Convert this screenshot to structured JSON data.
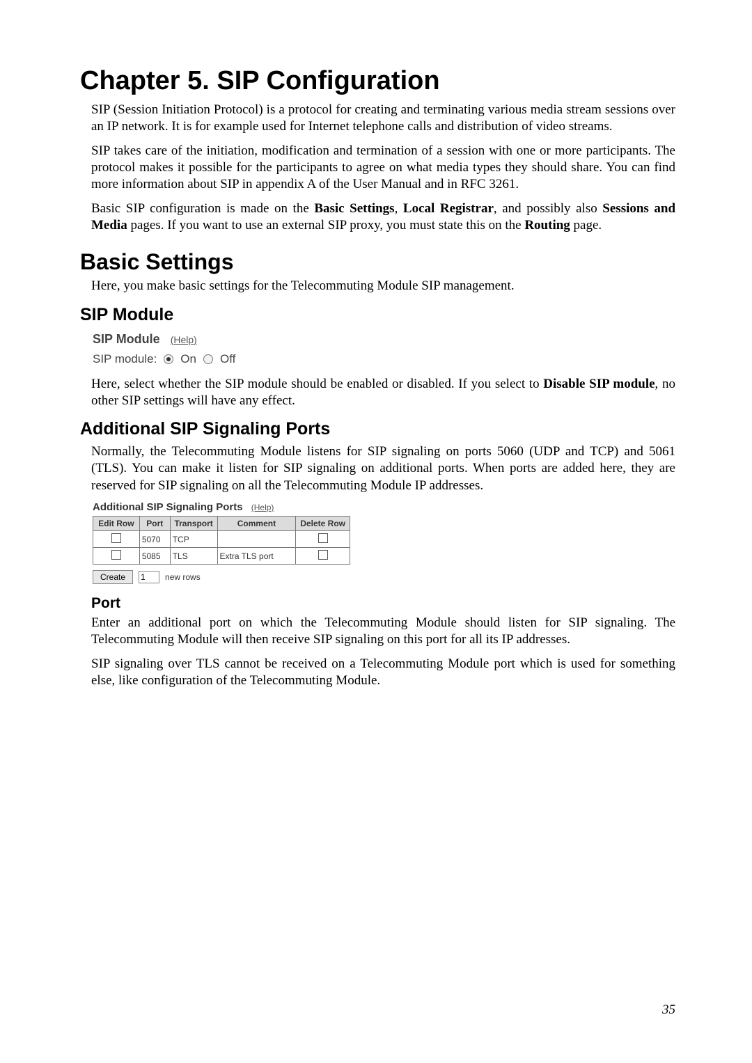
{
  "chapter_title": "Chapter 5. SIP Configuration",
  "para_intro": "SIP (Session Initiation Protocol) is a protocol for creating and terminating various media stream sessions over an IP network. It is for example used for Internet telephone calls and distribution of video streams.",
  "para_intro2": "SIP takes care of the initiation, modification and termination of a session with one or more participants. The protocol makes it possible for the participants to agree on what media types they should share. You can find more information about SIP in appendix A of the User Manual and in RFC 3261.",
  "para_intro3": {
    "pre": "Basic SIP configuration is made on the ",
    "b1": "Basic Settings",
    "mid1": ", ",
    "b2": "Local Registrar",
    "mid2": ", and possibly also ",
    "b3": "Sessions and Media",
    "mid3": " pages. If you want to use an external SIP proxy, you must state this on the ",
    "b4": "Routing",
    "post": " page."
  },
  "h2_basic": "Basic Settings",
  "p_basic": "Here, you make basic settings for the Telecommuting Module SIP management.",
  "h3_sip_module": "SIP Module",
  "fig_sip_module": {
    "header": "SIP Module",
    "help": "(Help)",
    "label": "SIP module:",
    "on": "On",
    "off": "Off"
  },
  "p_sip_module": {
    "pre": "Here, select whether the SIP module should be enabled or disabled. If you select to ",
    "b1": "Disable SIP module",
    "post": ", no other SIP settings will have any effect."
  },
  "h3_ports": "Additional SIP Signaling Ports",
  "p_ports": "Normally, the Telecommuting Module listens for SIP signaling on ports 5060 (UDP and TCP) and 5061 (TLS). You can make it listen for SIP signaling on additional ports. When ports are added here, they are reserved for SIP signaling on all the Telecommuting Module IP addresses.",
  "fig_ports": {
    "title": "Additional SIP Signaling Ports",
    "help": "(Help)",
    "headers": {
      "edit": "Edit Row",
      "port": "Port",
      "transport": "Transport",
      "comment": "Comment",
      "delete": "Delete Row"
    },
    "rows": [
      {
        "port": "5070",
        "transport": "TCP",
        "comment": ""
      },
      {
        "port": "5085",
        "transport": "TLS",
        "comment": "Extra TLS port"
      }
    ],
    "create_label": "Create",
    "create_value": "1",
    "new_rows": "new rows"
  },
  "h4_port": "Port",
  "p_port1": "Enter an additional port on which the Telecommuting Module should listen for SIP signaling. The Telecommuting Module will then receive SIP signaling on this port for all its IP addresses.",
  "p_port2": "SIP signaling over TLS cannot be received on a Telecommuting Module port which is used for something else, like configuration of the Telecommuting Module.",
  "page_number": "35"
}
